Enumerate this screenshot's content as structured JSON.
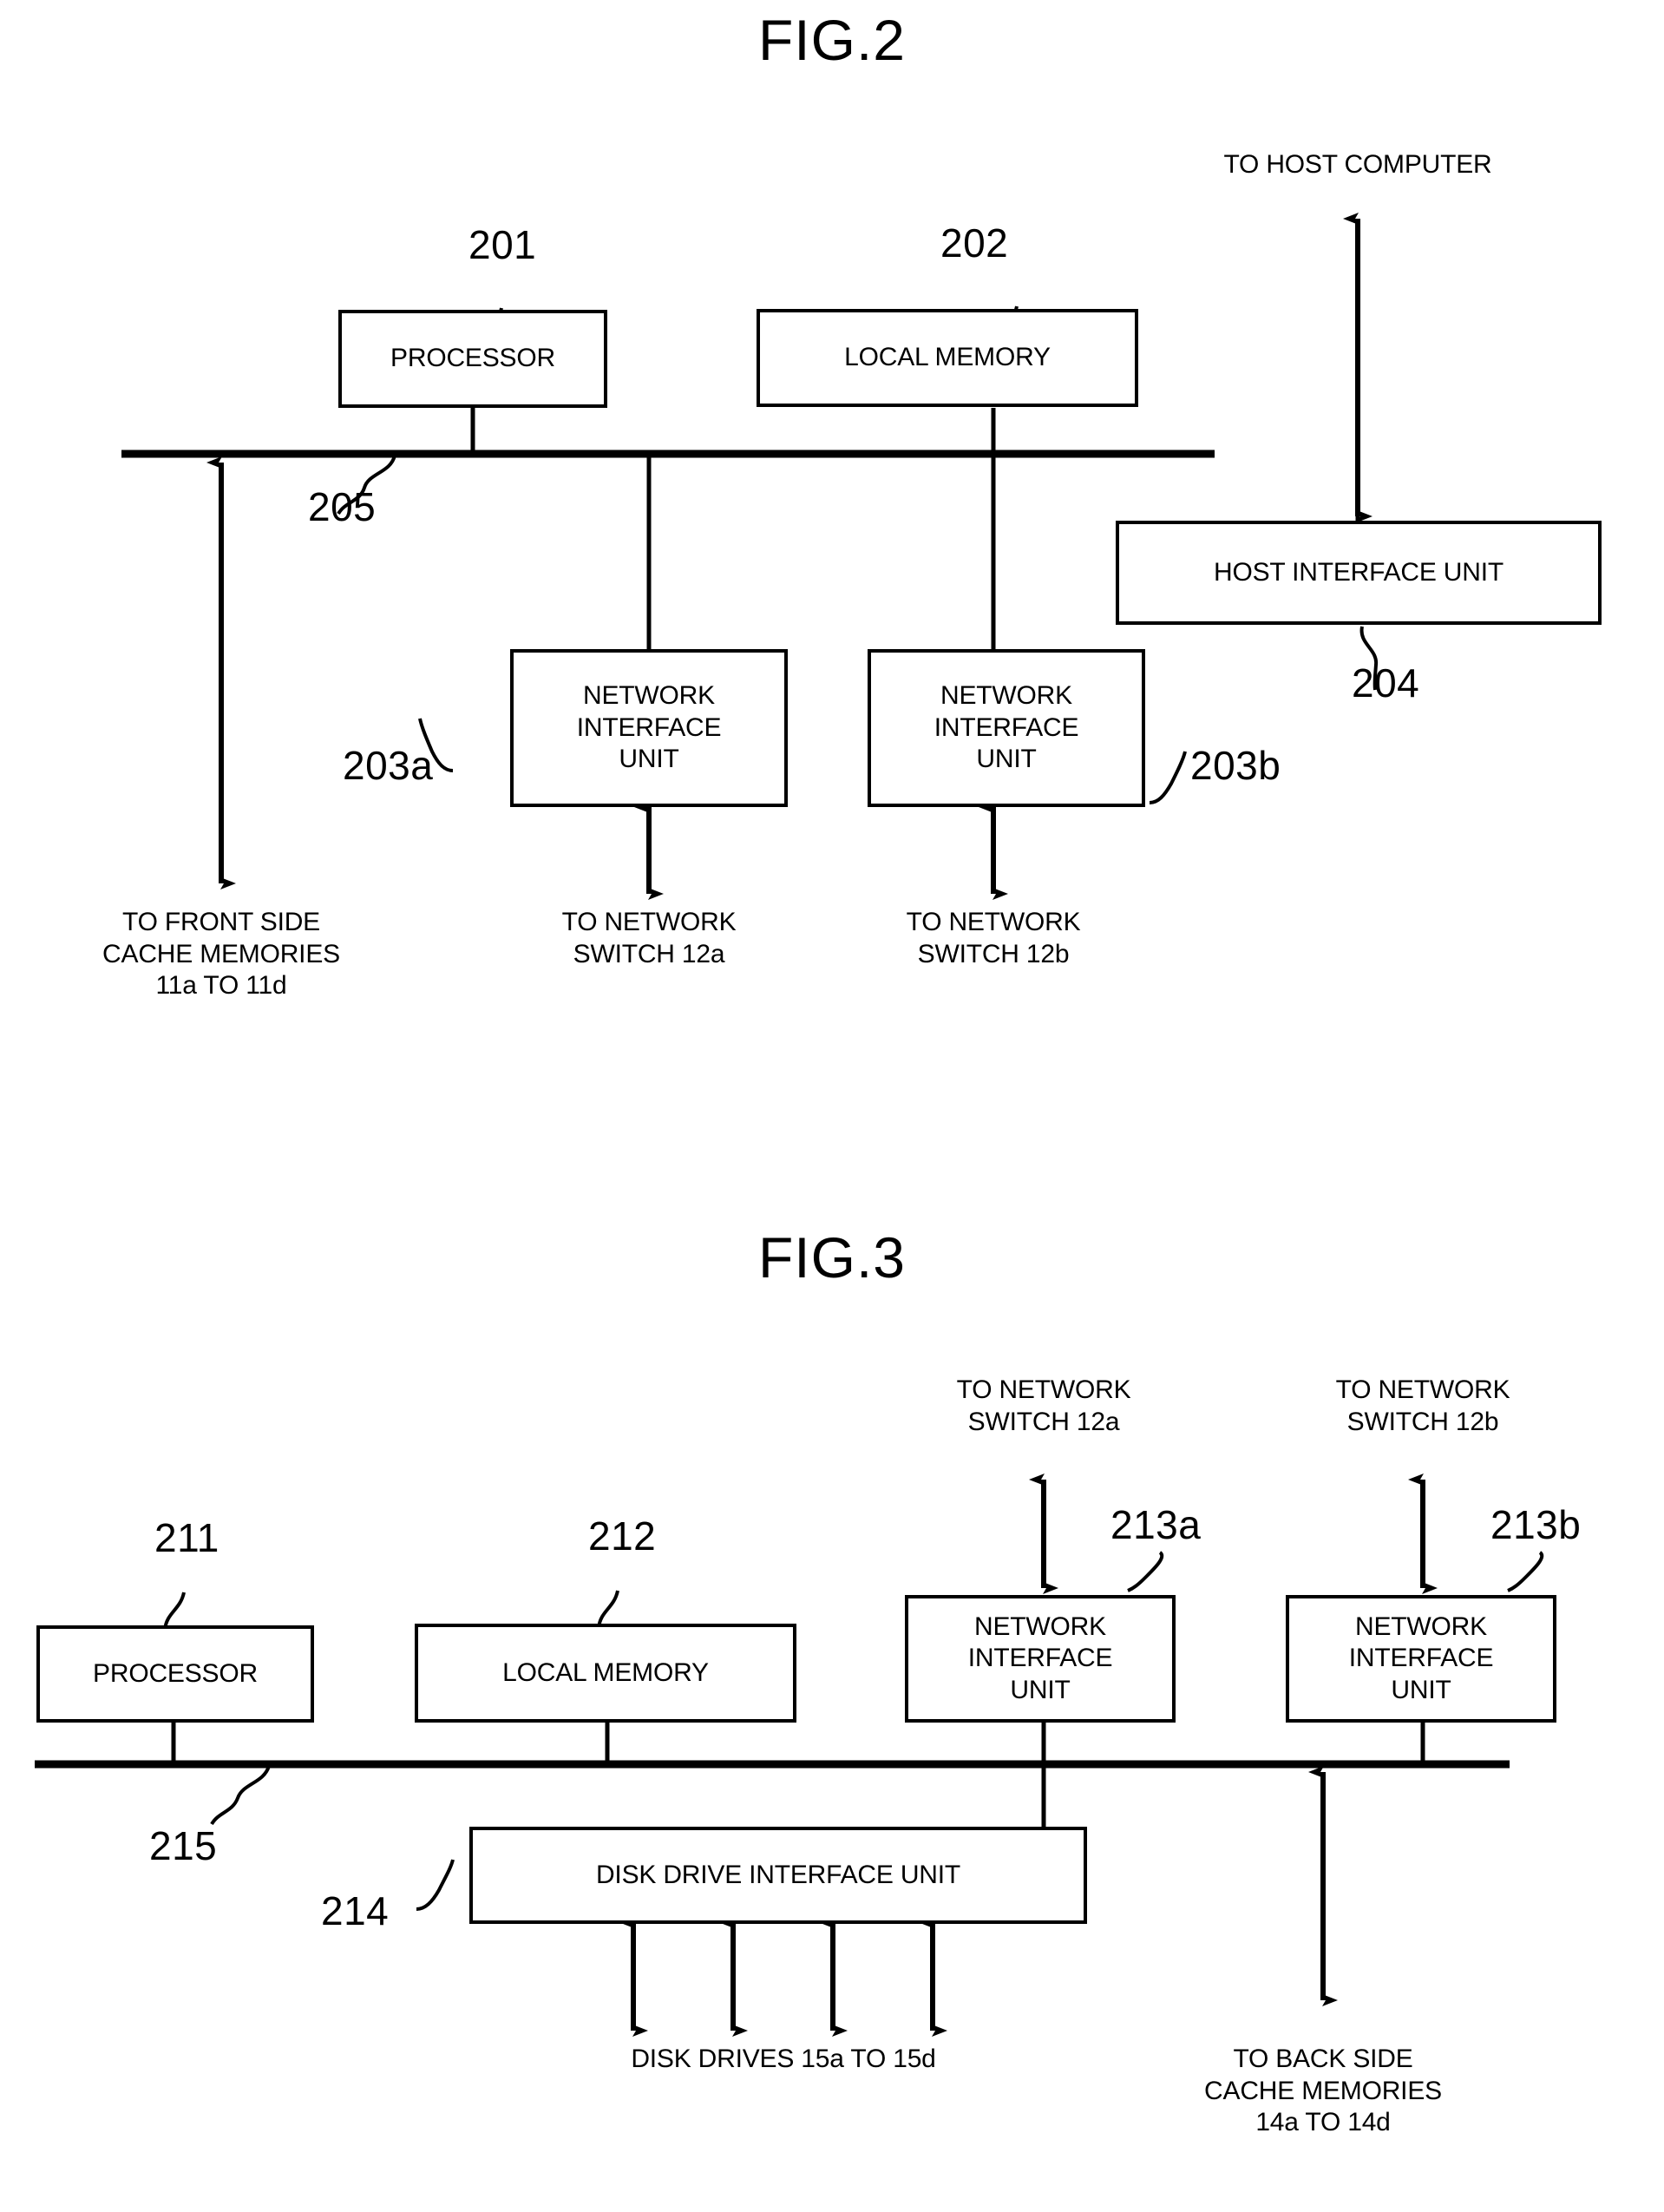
{
  "figures": [
    {
      "title": "FIG.2",
      "blocks": [
        {
          "id": "processor",
          "label": "PROCESSOR",
          "ref": "201"
        },
        {
          "id": "local_memory",
          "label": "LOCAL MEMORY",
          "ref": "202"
        },
        {
          "id": "network_interface_unit_a",
          "label": "NETWORK\nINTERFACE\nUNIT",
          "ref": "203a"
        },
        {
          "id": "network_interface_unit_b",
          "label": "NETWORK\nINTERFACE\nUNIT",
          "ref": "203b"
        },
        {
          "id": "host_interface_unit",
          "label": "HOST INTERFACE UNIT",
          "ref": "204"
        }
      ],
      "bus_ref": "205",
      "captions": [
        {
          "id": "to_host_computer",
          "lines": [
            "TO HOST COMPUTER"
          ]
        },
        {
          "id": "to_front_side_cache_memories",
          "lines": [
            "TO FRONT SIDE",
            "CACHE MEMORIES",
            "11a TO 11d"
          ]
        },
        {
          "id": "to_network_switch_12a",
          "lines": [
            "TO NETWORK",
            "SWITCH 12a"
          ]
        },
        {
          "id": "to_network_switch_12b",
          "lines": [
            "TO NETWORK",
            "SWITCH 12b"
          ]
        }
      ]
    },
    {
      "title": "FIG.3",
      "blocks": [
        {
          "id": "processor",
          "label": "PROCESSOR",
          "ref": "211"
        },
        {
          "id": "local_memory",
          "label": "LOCAL MEMORY",
          "ref": "212"
        },
        {
          "id": "network_interface_unit_a",
          "label": "NETWORK\nINTERFACE\nUNIT",
          "ref": "213a"
        },
        {
          "id": "network_interface_unit_b",
          "label": "NETWORK\nINTERFACE\nUNIT",
          "ref": "213b"
        },
        {
          "id": "disk_drive_interface_unit",
          "label": "DISK DRIVE INTERFACE UNIT",
          "ref": "214"
        }
      ],
      "bus_ref": "215",
      "captions": [
        {
          "id": "to_network_switch_12a",
          "lines": [
            "TO NETWORK",
            "SWITCH 12a"
          ]
        },
        {
          "id": "to_network_switch_12b",
          "lines": [
            "TO NETWORK",
            "SWITCH 12b"
          ]
        },
        {
          "id": "disk_drives",
          "lines": [
            "DISK DRIVES 15a TO 15d"
          ]
        },
        {
          "id": "to_back_side_cache_memories",
          "lines": [
            "TO BACK SIDE",
            "CACHE MEMORIES",
            "14a TO 14d"
          ]
        }
      ]
    }
  ],
  "fig2": {
    "title": "FIG.2",
    "processor_label": "PROCESSOR",
    "processor_ref": "201",
    "local_memory_label": "LOCAL MEMORY",
    "local_memory_ref": "202",
    "niu_a_line1": "NETWORK",
    "niu_a_line2": "INTERFACE",
    "niu_a_line3": "UNIT",
    "niu_a_ref": "203a",
    "niu_b_line1": "NETWORK",
    "niu_b_line2": "INTERFACE",
    "niu_b_line3": "UNIT",
    "niu_b_ref": "203b",
    "hiu_label": "HOST INTERFACE UNIT",
    "hiu_ref": "204",
    "bus_ref": "205",
    "cap_host_l1": "TO HOST COMPUTER",
    "cap_front_l1": "TO FRONT SIDE",
    "cap_front_l2": "CACHE MEMORIES",
    "cap_front_l3": "11a TO 11d",
    "cap_sw12a_l1": "TO NETWORK",
    "cap_sw12a_l2": "SWITCH 12a",
    "cap_sw12b_l1": "TO NETWORK",
    "cap_sw12b_l2": "SWITCH 12b"
  },
  "fig3": {
    "title": "FIG.3",
    "processor_label": "PROCESSOR",
    "processor_ref": "211",
    "local_memory_label": "LOCAL MEMORY",
    "local_memory_ref": "212",
    "niu_a_line1": "NETWORK",
    "niu_a_line2": "INTERFACE",
    "niu_a_line3": "UNIT",
    "niu_a_ref": "213a",
    "niu_b_line1": "NETWORK",
    "niu_b_line2": "INTERFACE",
    "niu_b_line3": "UNIT",
    "niu_b_ref": "213b",
    "ddiu_label": "DISK DRIVE INTERFACE UNIT",
    "ddiu_ref": "214",
    "bus_ref": "215",
    "cap_sw12a_l1": "TO NETWORK",
    "cap_sw12a_l2": "SWITCH 12a",
    "cap_sw12b_l1": "TO NETWORK",
    "cap_sw12b_l2": "SWITCH 12b",
    "cap_disk_l1": "DISK DRIVES 15a TO 15d",
    "cap_back_l1": "TO BACK SIDE",
    "cap_back_l2": "CACHE MEMORIES",
    "cap_back_l3": "14a TO 14d"
  },
  "colors": {
    "ink": "#000000",
    "paper": "#ffffff"
  }
}
